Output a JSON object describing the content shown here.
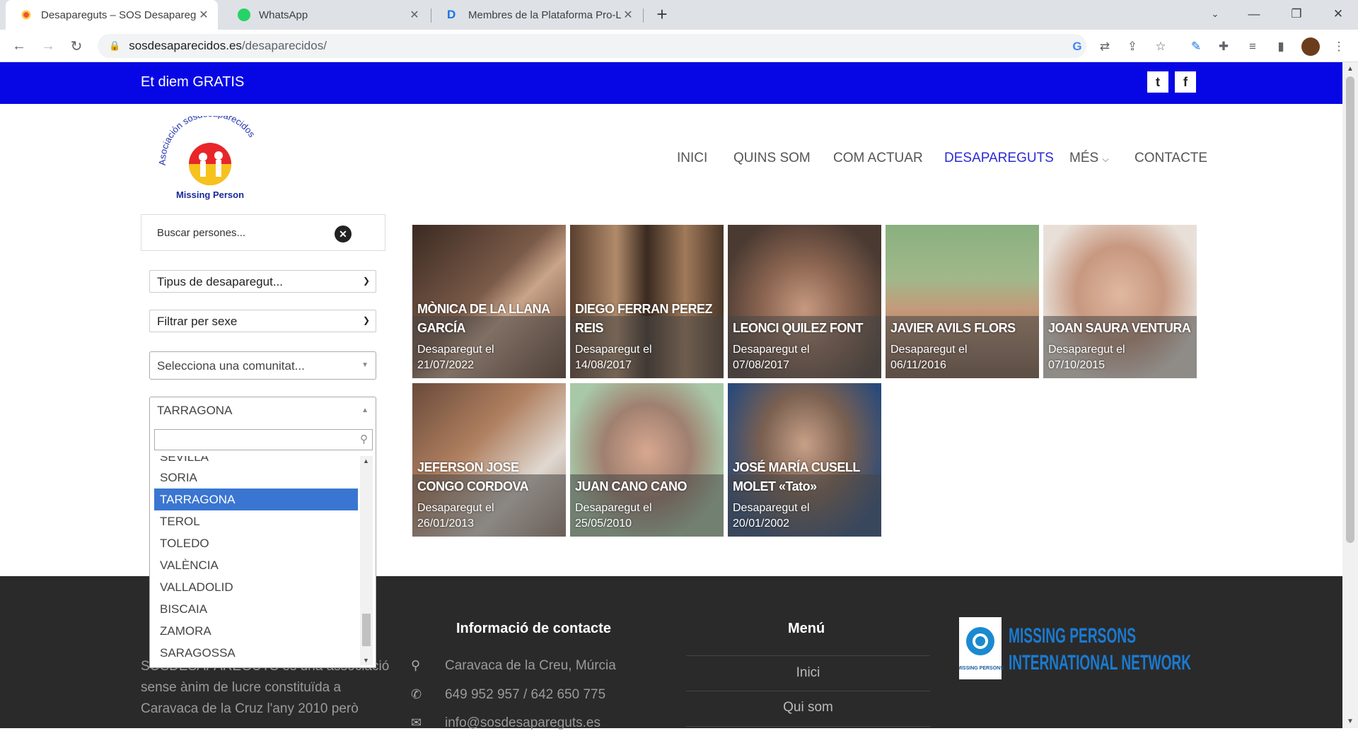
{
  "browser": {
    "tabs": [
      {
        "title": "Desapareguts – SOS Desaparegu",
        "active": true
      },
      {
        "title": "WhatsApp",
        "active": false
      },
      {
        "title": "Membres de la Plataforma Pro-Ll",
        "active": false
      }
    ],
    "url_host": "sosdesaparecidos.es",
    "url_path": "/desaparecidos/"
  },
  "topbar": {
    "slogan": "Et diem GRATIS",
    "twitter": "t",
    "facebook": "f"
  },
  "logo": {
    "arc_text": "Asociación sosdesaparecidos",
    "caption": "Missing Person"
  },
  "nav": [
    "INICI",
    "QUINS SOM",
    "COM ACTUAR",
    "DESAPAREGUTS",
    "MÉS",
    "CONTACTE"
  ],
  "filters": {
    "search_placeholder": "Buscar persones...",
    "type": "Tipus de desaparegut...",
    "sex": "Filtrar per sexe",
    "community": "Selecciona una comunitat...",
    "province": "TARRAGONA",
    "province_options": [
      "SEVILLA",
      "SORIA",
      "TARRAGONA",
      "TEROL",
      "TOLEDO",
      "VALÈNCIA",
      "VALLADOLID",
      "BISCAIA",
      "ZAMORA",
      "SARAGOSSA"
    ]
  },
  "cards": [
    {
      "name": "MÒNICA DE LA LLANA GARCÍA",
      "label": "Desaparegut el",
      "date": "21/07/2022"
    },
    {
      "name": "DIEGO FERRAN PEREZ REIS",
      "label": "Desaparegut el",
      "date": "14/08/2017"
    },
    {
      "name": "LEONCI QUILEZ FONT",
      "label": "Desaparegut el",
      "date": "07/08/2017"
    },
    {
      "name": "JAVIER AVILS FLORS",
      "label": "Desaparegut el",
      "date": "06/11/2016"
    },
    {
      "name": "JOAN SAURA VENTURA",
      "label": "Desaparegut el",
      "date": "07/10/2015"
    },
    {
      "name": "JEFERSON JOSE CONGO CORDOVA",
      "label": "Desaparegut el",
      "date": "26/01/2013"
    },
    {
      "name": "JUAN CANO CANO",
      "label": "Desaparegut el",
      "date": "25/05/2010"
    },
    {
      "name": "JOSÉ MARÍA CUSELL MOLET «Tato»",
      "label": "Desaparegut el",
      "date": "20/01/2002"
    }
  ],
  "footer": {
    "contact_heading": "Informació de contacte",
    "menu_heading": "Menú",
    "address": "Caravaca de la Creu, Múrcia",
    "phones": "649 952 957 / 642 650 775",
    "email": "info@sosdesapareguts.es",
    "menu": [
      "Inici",
      "Qui som"
    ],
    "about_line1": "SOSDESAPAREGUTS és una associació",
    "about_line2": "sense ànim de lucre constituïda a",
    "about_line3": "Caravaca de la Cruz l'any 2010 però",
    "mpin_line1": "MISSING PERSONS",
    "mpin_line2": "INTERNATIONAL NETWORK",
    "mpin_badge": "MISSING PERSONS"
  },
  "colors": {
    "brand_blue": "#0707e6",
    "nav_active": "#2b2bd3",
    "footer_bg": "#2a2a2a",
    "select_highlight": "#3a76d1"
  }
}
